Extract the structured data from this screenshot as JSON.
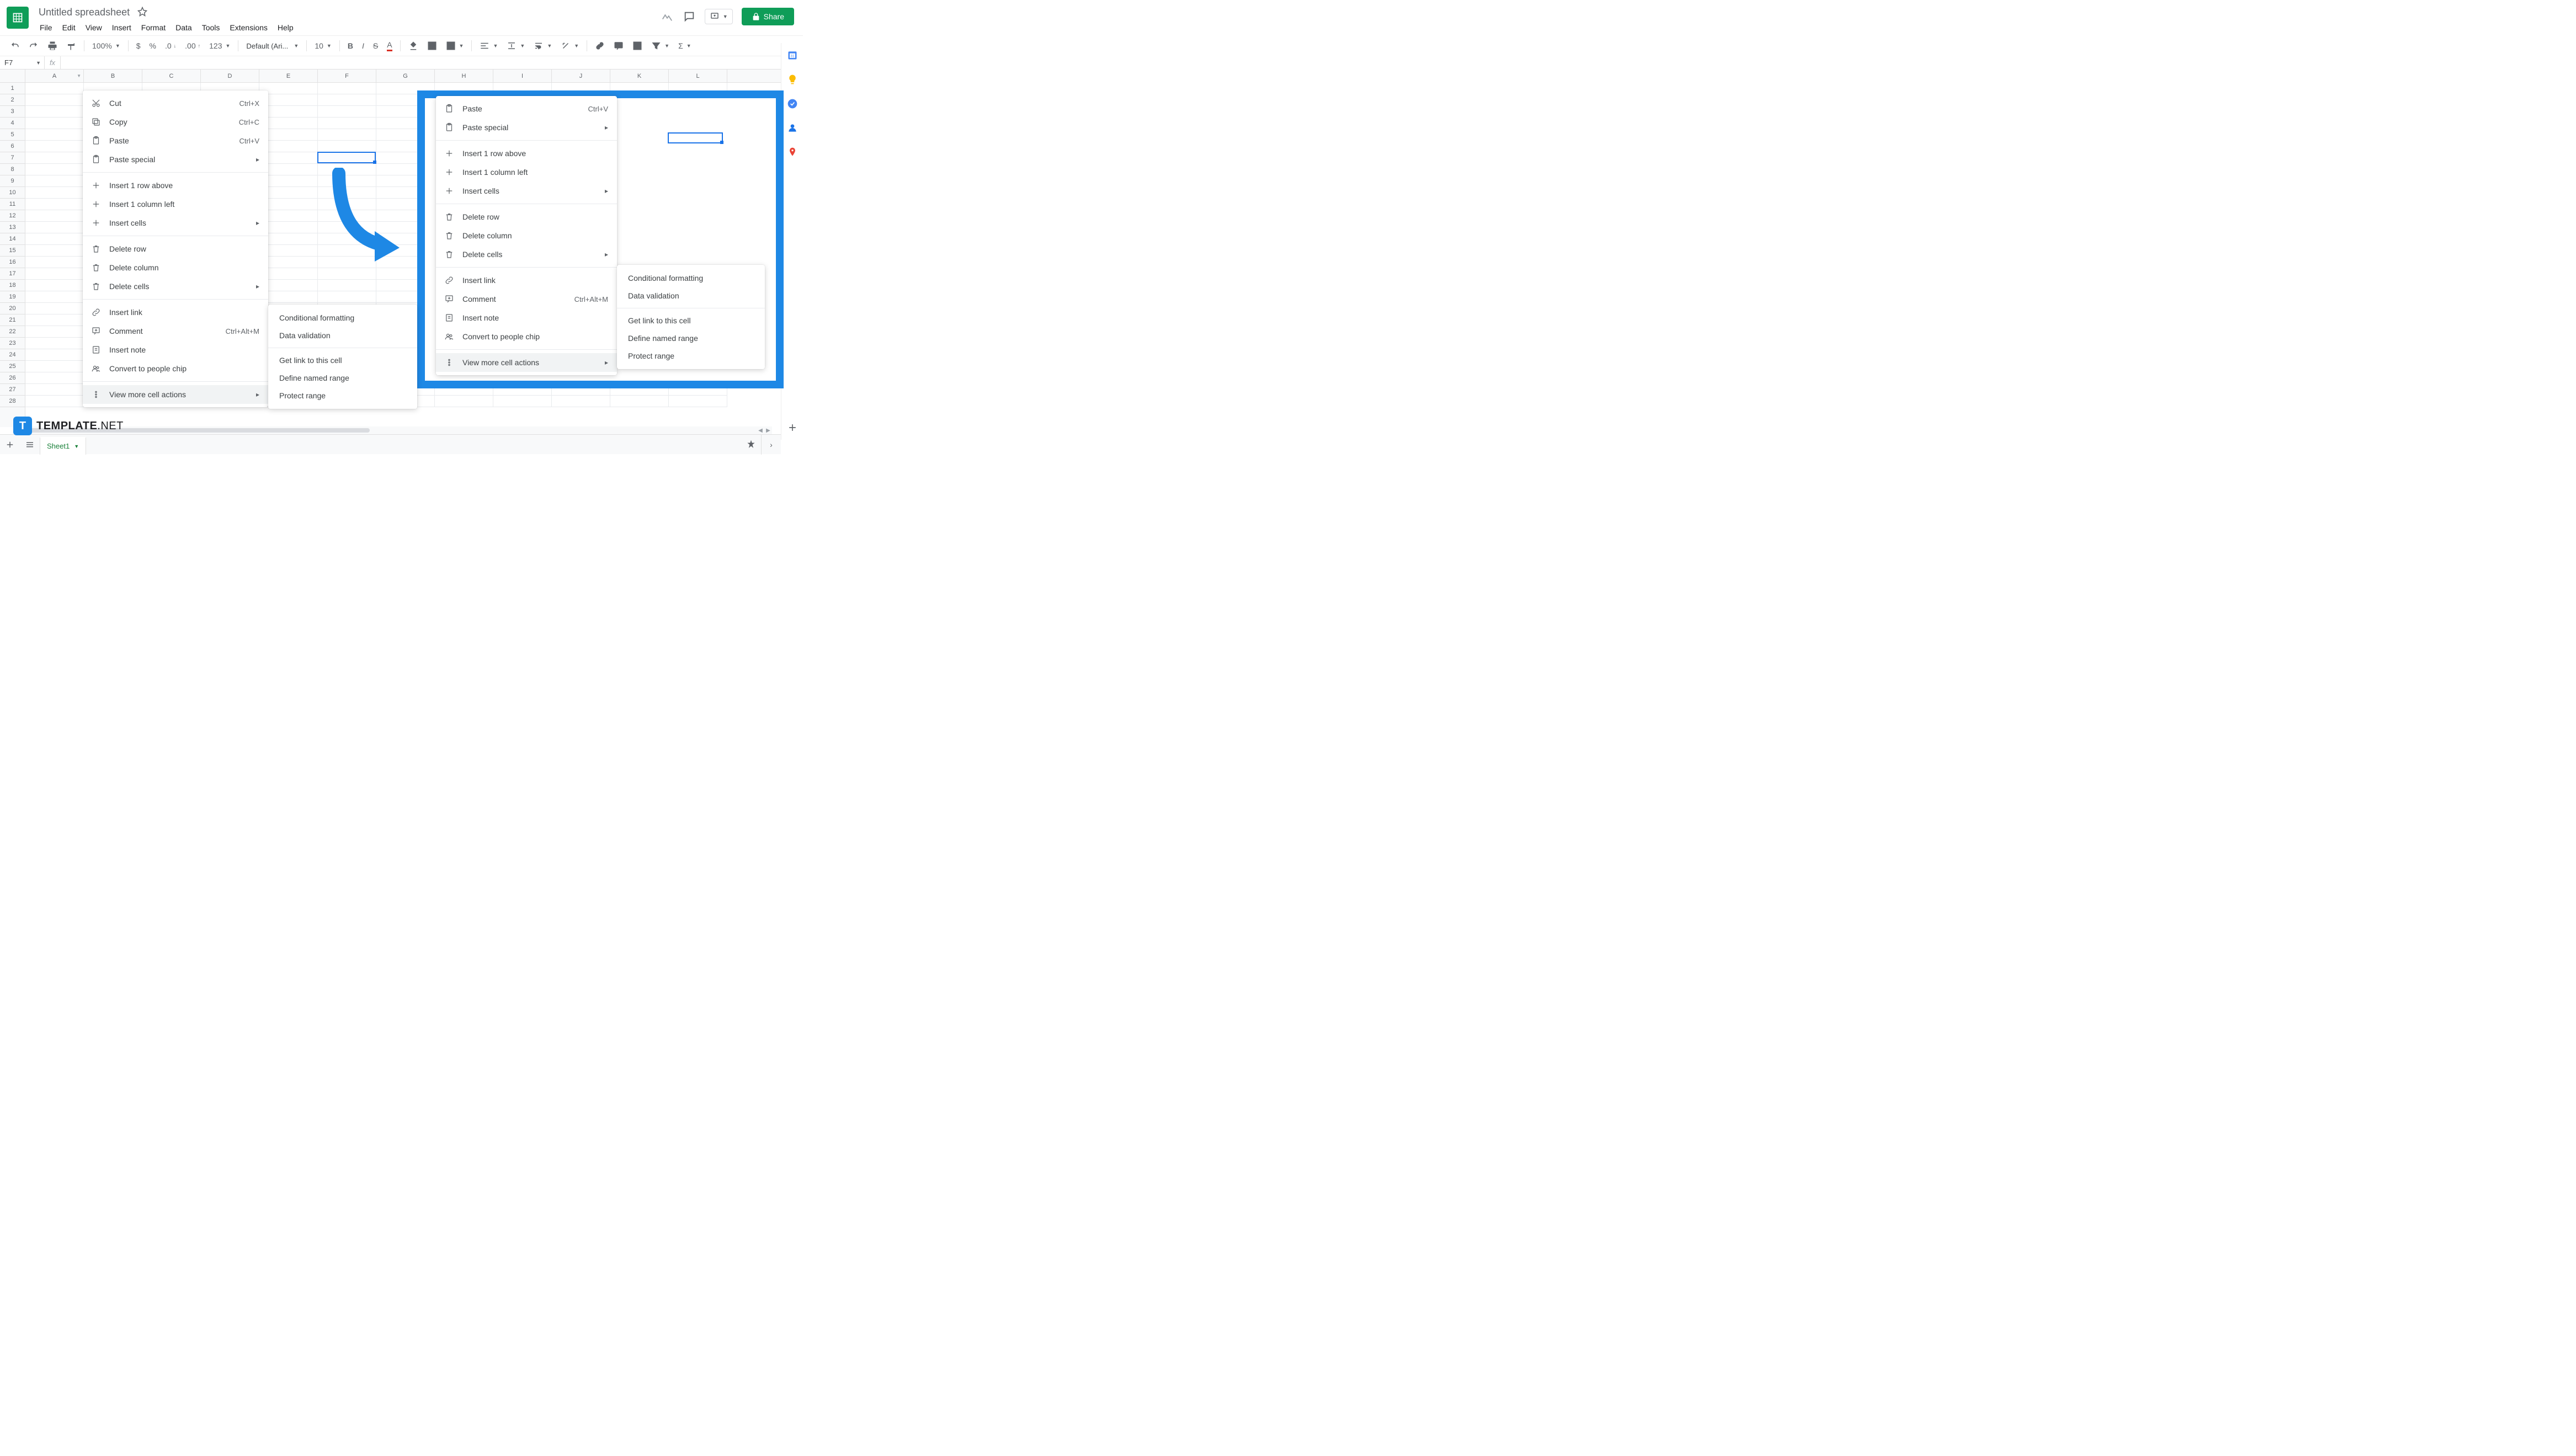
{
  "header": {
    "doc_title": "Untitled spreadsheet",
    "menus": [
      "File",
      "Edit",
      "View",
      "Insert",
      "Format",
      "Data",
      "Tools",
      "Extensions",
      "Help"
    ],
    "share_label": "Share"
  },
  "toolbar": {
    "zoom": "100%",
    "font": "Default (Ari...",
    "font_size": "10",
    "more_formats": "123"
  },
  "name_box": "F7",
  "columns": [
    "A",
    "B",
    "C",
    "D",
    "E",
    "F",
    "G",
    "H",
    "I",
    "J",
    "K",
    "L"
  ],
  "row_count": 28,
  "selected_cell_left": {
    "col": 5,
    "row": 6
  },
  "context_menu_left": {
    "groups": [
      [
        {
          "icon": "cut",
          "label": "Cut",
          "kbd": "Ctrl+X"
        },
        {
          "icon": "copy",
          "label": "Copy",
          "kbd": "Ctrl+C"
        },
        {
          "icon": "paste",
          "label": "Paste",
          "kbd": "Ctrl+V"
        },
        {
          "icon": "paste",
          "label": "Paste special",
          "sub": "▸"
        }
      ],
      [
        {
          "icon": "plus",
          "label": "Insert 1 row above"
        },
        {
          "icon": "plus",
          "label": "Insert 1 column left"
        },
        {
          "icon": "plus",
          "label": "Insert cells",
          "sub": "▸"
        }
      ],
      [
        {
          "icon": "trash",
          "label": "Delete row"
        },
        {
          "icon": "trash",
          "label": "Delete column"
        },
        {
          "icon": "trash",
          "label": "Delete cells",
          "sub": "▸"
        }
      ],
      [
        {
          "icon": "link",
          "label": "Insert link"
        },
        {
          "icon": "comment",
          "label": "Comment",
          "kbd": "Ctrl+Alt+M"
        },
        {
          "icon": "note",
          "label": "Insert note"
        },
        {
          "icon": "people",
          "label": "Convert to people chip"
        }
      ],
      [
        {
          "icon": "dots",
          "label": "View more cell actions",
          "sub": "▸",
          "hl": true
        }
      ]
    ]
  },
  "context_menu_right": {
    "groups": [
      [
        {
          "icon": "paste",
          "label": "Paste",
          "kbd": "Ctrl+V"
        },
        {
          "icon": "paste",
          "label": "Paste special",
          "sub": "▸"
        }
      ],
      [
        {
          "icon": "plus",
          "label": "Insert 1 row above"
        },
        {
          "icon": "plus",
          "label": "Insert 1 column left"
        },
        {
          "icon": "plus",
          "label": "Insert cells",
          "sub": "▸"
        }
      ],
      [
        {
          "icon": "trash",
          "label": "Delete row"
        },
        {
          "icon": "trash",
          "label": "Delete column"
        },
        {
          "icon": "trash",
          "label": "Delete cells",
          "sub": "▸"
        }
      ],
      [
        {
          "icon": "link",
          "label": "Insert link"
        },
        {
          "icon": "comment",
          "label": "Comment",
          "kbd": "Ctrl+Alt+M"
        },
        {
          "icon": "note",
          "label": "Insert note"
        },
        {
          "icon": "people",
          "label": "Convert to people chip"
        }
      ],
      [
        {
          "icon": "dots",
          "label": "View more cell actions",
          "sub": "▸",
          "hl": true
        }
      ]
    ]
  },
  "submenu": {
    "groups": [
      [
        "Conditional formatting",
        "Data validation"
      ],
      [
        "Get link to this cell",
        "Define named range",
        "Protect range"
      ]
    ]
  },
  "sheet_tab": "Sheet1",
  "watermark": {
    "badge": "T",
    "text_bold": "TEMPLATE",
    "text_thin": ".NET"
  }
}
